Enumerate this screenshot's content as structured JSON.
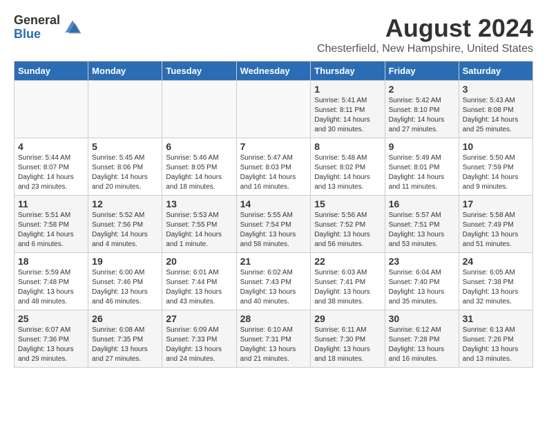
{
  "logo": {
    "general": "General",
    "blue": "Blue"
  },
  "title": "August 2024",
  "subtitle": "Chesterfield, New Hampshire, United States",
  "weekdays": [
    "Sunday",
    "Monday",
    "Tuesday",
    "Wednesday",
    "Thursday",
    "Friday",
    "Saturday"
  ],
  "weeks": [
    [
      {
        "date": "",
        "info": ""
      },
      {
        "date": "",
        "info": ""
      },
      {
        "date": "",
        "info": ""
      },
      {
        "date": "",
        "info": ""
      },
      {
        "date": "1",
        "info": "Sunrise: 5:41 AM\nSunset: 8:11 PM\nDaylight: 14 hours\nand 30 minutes."
      },
      {
        "date": "2",
        "info": "Sunrise: 5:42 AM\nSunset: 8:10 PM\nDaylight: 14 hours\nand 27 minutes."
      },
      {
        "date": "3",
        "info": "Sunrise: 5:43 AM\nSunset: 8:08 PM\nDaylight: 14 hours\nand 25 minutes."
      }
    ],
    [
      {
        "date": "4",
        "info": "Sunrise: 5:44 AM\nSunset: 8:07 PM\nDaylight: 14 hours\nand 23 minutes."
      },
      {
        "date": "5",
        "info": "Sunrise: 5:45 AM\nSunset: 8:06 PM\nDaylight: 14 hours\nand 20 minutes."
      },
      {
        "date": "6",
        "info": "Sunrise: 5:46 AM\nSunset: 8:05 PM\nDaylight: 14 hours\nand 18 minutes."
      },
      {
        "date": "7",
        "info": "Sunrise: 5:47 AM\nSunset: 8:03 PM\nDaylight: 14 hours\nand 16 minutes."
      },
      {
        "date": "8",
        "info": "Sunrise: 5:48 AM\nSunset: 8:02 PM\nDaylight: 14 hours\nand 13 minutes."
      },
      {
        "date": "9",
        "info": "Sunrise: 5:49 AM\nSunset: 8:01 PM\nDaylight: 14 hours\nand 11 minutes."
      },
      {
        "date": "10",
        "info": "Sunrise: 5:50 AM\nSunset: 7:59 PM\nDaylight: 14 hours\nand 9 minutes."
      }
    ],
    [
      {
        "date": "11",
        "info": "Sunrise: 5:51 AM\nSunset: 7:58 PM\nDaylight: 14 hours\nand 6 minutes."
      },
      {
        "date": "12",
        "info": "Sunrise: 5:52 AM\nSunset: 7:56 PM\nDaylight: 14 hours\nand 4 minutes."
      },
      {
        "date": "13",
        "info": "Sunrise: 5:53 AM\nSunset: 7:55 PM\nDaylight: 14 hours\nand 1 minute."
      },
      {
        "date": "14",
        "info": "Sunrise: 5:55 AM\nSunset: 7:54 PM\nDaylight: 13 hours\nand 58 minutes."
      },
      {
        "date": "15",
        "info": "Sunrise: 5:56 AM\nSunset: 7:52 PM\nDaylight: 13 hours\nand 56 minutes."
      },
      {
        "date": "16",
        "info": "Sunrise: 5:57 AM\nSunset: 7:51 PM\nDaylight: 13 hours\nand 53 minutes."
      },
      {
        "date": "17",
        "info": "Sunrise: 5:58 AM\nSunset: 7:49 PM\nDaylight: 13 hours\nand 51 minutes."
      }
    ],
    [
      {
        "date": "18",
        "info": "Sunrise: 5:59 AM\nSunset: 7:48 PM\nDaylight: 13 hours\nand 48 minutes."
      },
      {
        "date": "19",
        "info": "Sunrise: 6:00 AM\nSunset: 7:46 PM\nDaylight: 13 hours\nand 46 minutes."
      },
      {
        "date": "20",
        "info": "Sunrise: 6:01 AM\nSunset: 7:44 PM\nDaylight: 13 hours\nand 43 minutes."
      },
      {
        "date": "21",
        "info": "Sunrise: 6:02 AM\nSunset: 7:43 PM\nDaylight: 13 hours\nand 40 minutes."
      },
      {
        "date": "22",
        "info": "Sunrise: 6:03 AM\nSunset: 7:41 PM\nDaylight: 13 hours\nand 38 minutes."
      },
      {
        "date": "23",
        "info": "Sunrise: 6:04 AM\nSunset: 7:40 PM\nDaylight: 13 hours\nand 35 minutes."
      },
      {
        "date": "24",
        "info": "Sunrise: 6:05 AM\nSunset: 7:38 PM\nDaylight: 13 hours\nand 32 minutes."
      }
    ],
    [
      {
        "date": "25",
        "info": "Sunrise: 6:07 AM\nSunset: 7:36 PM\nDaylight: 13 hours\nand 29 minutes."
      },
      {
        "date": "26",
        "info": "Sunrise: 6:08 AM\nSunset: 7:35 PM\nDaylight: 13 hours\nand 27 minutes."
      },
      {
        "date": "27",
        "info": "Sunrise: 6:09 AM\nSunset: 7:33 PM\nDaylight: 13 hours\nand 24 minutes."
      },
      {
        "date": "28",
        "info": "Sunrise: 6:10 AM\nSunset: 7:31 PM\nDaylight: 13 hours\nand 21 minutes."
      },
      {
        "date": "29",
        "info": "Sunrise: 6:11 AM\nSunset: 7:30 PM\nDaylight: 13 hours\nand 18 minutes."
      },
      {
        "date": "30",
        "info": "Sunrise: 6:12 AM\nSunset: 7:28 PM\nDaylight: 13 hours\nand 16 minutes."
      },
      {
        "date": "31",
        "info": "Sunrise: 6:13 AM\nSunset: 7:26 PM\nDaylight: 13 hours\nand 13 minutes."
      }
    ]
  ]
}
